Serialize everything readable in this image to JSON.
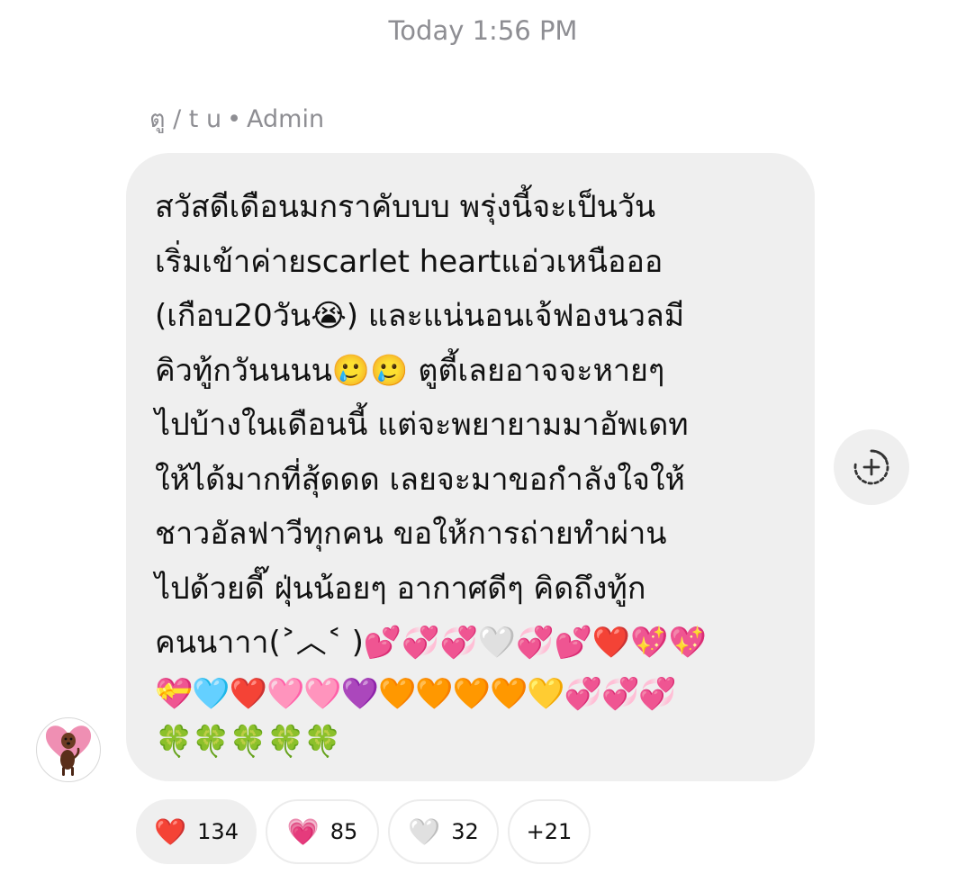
{
  "timestamp": "Today 1:56 PM",
  "sender": {
    "name": "ตู / t u",
    "separator": "•",
    "role": "Admin"
  },
  "message": {
    "lines": [
      "สวัสดีเดือนมกราคับบบ พรุ่งนี้จะเป็นวัน",
      "เริ่มเข้าค่ายscarlet heartแอ่วเหนือออ",
      "(เกือบ20วัน😭) และแน่นอนเจ้ฟองนวลมี",
      "คิวทู้กวันนนน🥲🥲 ตูตี้เลยอาจจะหายๆ",
      "ไปบ้างในเดือนนี้ แต่จะพยายามมาอัพเดท",
      "ให้ได้มากที่สุ้ดดด เลยจะมาขอกำลังใจให้",
      "ชาวอัลฟาวีทุกคน ขอให้การถ่ายทำผ่าน",
      "ไปด้วยดี๊ ฝุ่นน้อยๆ อากาศดีๆ คิดถึงทู้ก",
      "คนนาาา(˃︿˂ )💕💞💞🤍💞💕❤️💖💖"
    ],
    "emoji_lines": [
      "💝🩵❤️🩷🩷💜🧡🧡🧡🧡💛💞💞💞",
      "🍀🍀🍀🍀🍀"
    ]
  },
  "reactions": [
    {
      "emoji": "❤️",
      "count": "134",
      "active": true
    },
    {
      "emoji": "💗",
      "count": "85",
      "active": false
    },
    {
      "emoji": "🤍",
      "count": "32",
      "active": false
    }
  ],
  "more_reactions": "+21",
  "icons": {
    "add_reaction": "add-reaction-icon",
    "avatar": "heart-dog-avatar"
  },
  "colors": {
    "bubble": "#efefef",
    "muted_text": "#8e8e93"
  }
}
